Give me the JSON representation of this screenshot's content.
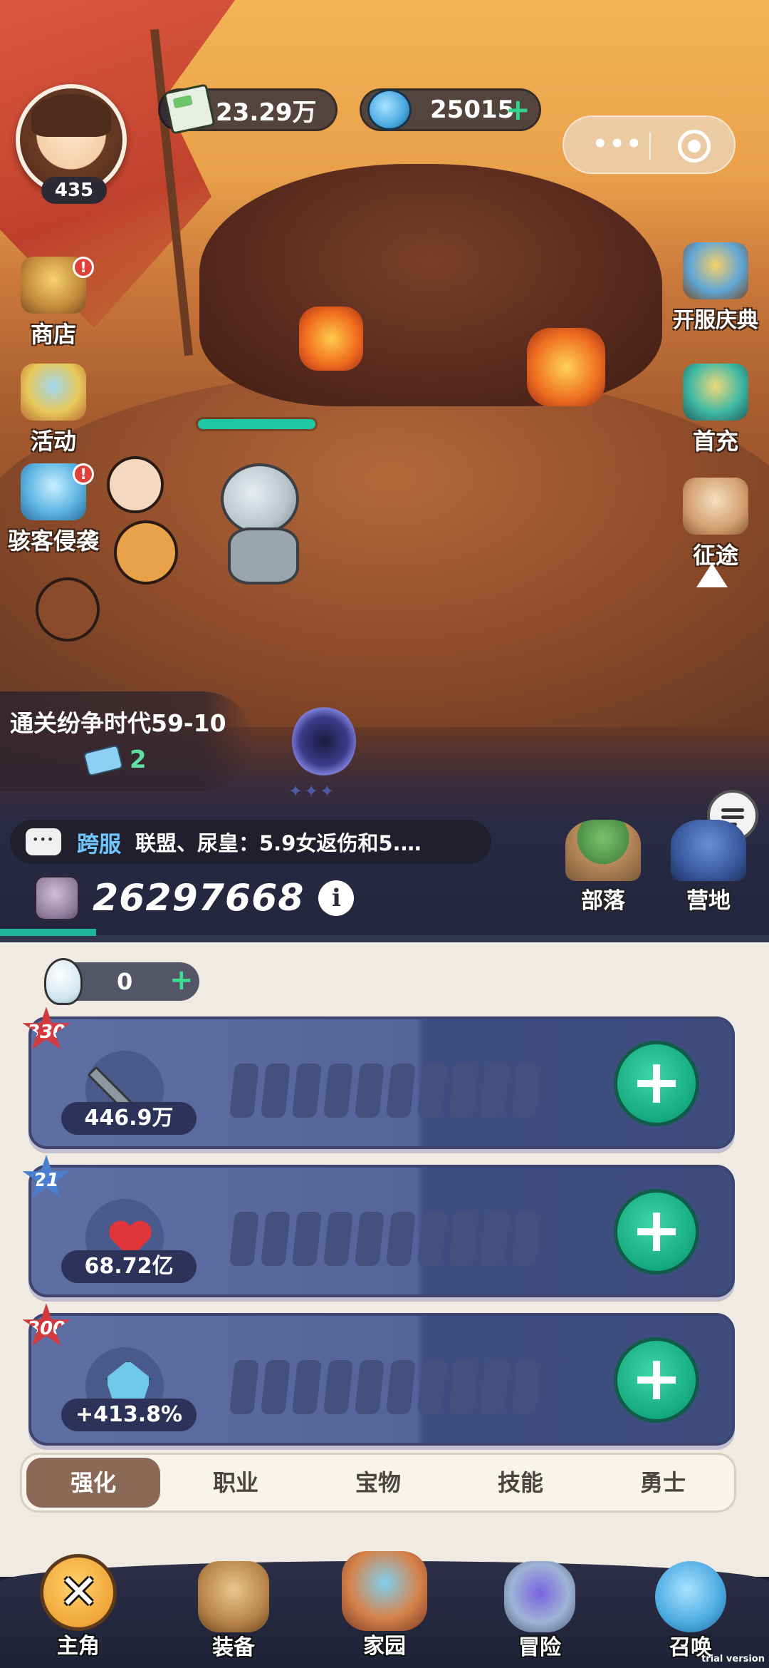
{
  "player": {
    "level": "435"
  },
  "resources": {
    "exp": {
      "value": "23.29万",
      "icon": "exp-scroll-icon"
    },
    "gems": {
      "value": "25015",
      "plus": "+"
    }
  },
  "left_menu": [
    {
      "label": "商店",
      "alert": "!"
    },
    {
      "label": "活动"
    },
    {
      "label": "骇客侵袭",
      "alert": "!"
    }
  ],
  "right_menu": [
    {
      "label": "开服庆典"
    },
    {
      "label": "首充"
    },
    {
      "label": "征途"
    }
  ],
  "stage": {
    "title": "通关纷争时代59-10",
    "ticket_count": "2",
    "stars": "✦✦✦"
  },
  "chat": {
    "channel": "跨服",
    "message": "联盟、尿皇：5.9女返伤和5.…"
  },
  "camp": [
    {
      "label": "部落"
    },
    {
      "label": "营地"
    }
  ],
  "power": {
    "value": "26297668",
    "info": "i"
  },
  "bulb": {
    "count": "0",
    "plus": "+"
  },
  "upgrades": [
    {
      "badge": "330",
      "badge_color": "#d33a3f",
      "stat": "sword-icon",
      "value": "446.9万",
      "plus": "+"
    },
    {
      "badge": "21",
      "badge_color": "#4a7fd0",
      "stat": "heart-icon",
      "value": "68.72亿",
      "plus": "+"
    },
    {
      "badge": "300",
      "badge_color": "#d33a3f",
      "stat": "crystal-sword-icon",
      "value": "+413.8%",
      "plus": "+"
    }
  ],
  "tabs": [
    {
      "label": "强化",
      "active": true
    },
    {
      "label": "职业"
    },
    {
      "label": "宝物"
    },
    {
      "label": "技能"
    },
    {
      "label": "勇士"
    }
  ],
  "nav": [
    {
      "label": "主角",
      "icon": "close-icon"
    },
    {
      "label": "装备",
      "icon": "slingshot-icon"
    },
    {
      "label": "家园",
      "icon": "castle-icon"
    },
    {
      "label": "冒险",
      "icon": "portal-icon"
    },
    {
      "label": "召唤",
      "icon": "summon-orb-icon"
    }
  ],
  "watermark": "trial version",
  "colors": {
    "accent": "#1fc7a2",
    "tab_active": "#8a6a57",
    "plus_green": "#16a97f"
  }
}
